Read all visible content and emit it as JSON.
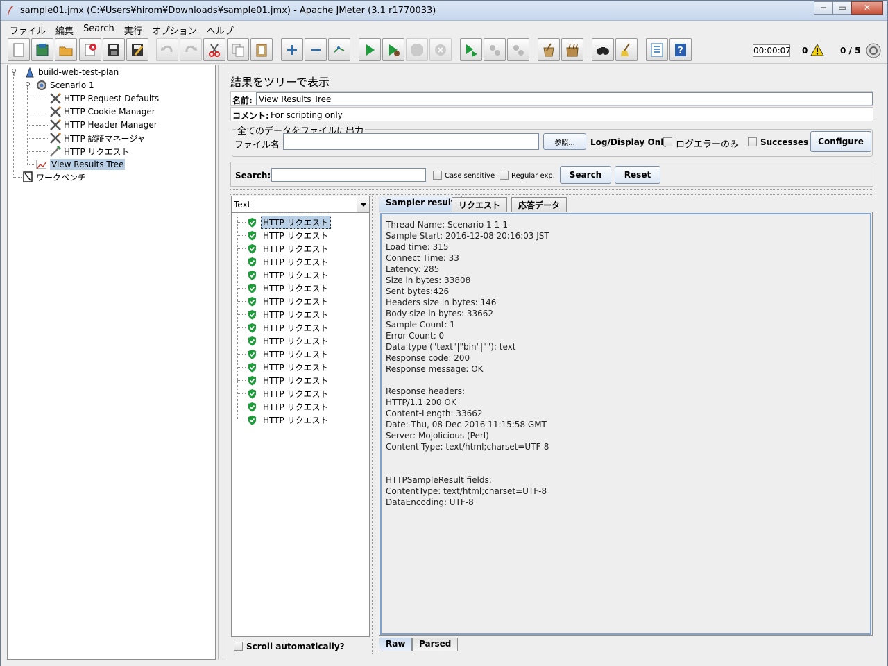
{
  "window": {
    "title": "sample01.jmx (C:¥Users¥hirom¥Downloads¥sample01.jmx) - Apache JMeter (3.1 r1770033)",
    "minimize": "─",
    "maximize": "▭",
    "close": "✕"
  },
  "menu": [
    "ファイル",
    "編集",
    "Search",
    "実行",
    "オプション",
    "ヘルプ"
  ],
  "toolbar": {
    "buttons": [
      {
        "name": "new-icon"
      },
      {
        "name": "templates-icon"
      },
      {
        "name": "open-icon"
      },
      {
        "name": "close-icon"
      },
      {
        "name": "save-icon"
      },
      {
        "name": "save-as-icon"
      },
      {
        "name": "undo-icon"
      },
      {
        "name": "redo-icon"
      },
      {
        "name": "cut-icon"
      },
      {
        "name": "copy-icon"
      },
      {
        "name": "paste-icon"
      },
      {
        "name": "expand-icon"
      },
      {
        "name": "collapse-icon"
      },
      {
        "name": "toggle-icon"
      },
      {
        "name": "start-icon"
      },
      {
        "name": "start-no-pause-icon"
      },
      {
        "name": "stop-icon"
      },
      {
        "name": "shutdown-icon"
      },
      {
        "name": "remote-start-icon"
      },
      {
        "name": "remote-stop-icon"
      },
      {
        "name": "remote-shutdown-icon"
      },
      {
        "name": "clear-icon"
      },
      {
        "name": "clear-all-icon"
      },
      {
        "name": "search-icon"
      },
      {
        "name": "reset-search-icon"
      },
      {
        "name": "function-helper-icon"
      },
      {
        "name": "help-icon"
      }
    ],
    "elapsed": "00:00:07",
    "error_count": "0",
    "threads": "0 / 5"
  },
  "tree": {
    "nodes": [
      {
        "label": "build-web-test-plan",
        "icon": "test-plan-icon"
      },
      {
        "label": "Scenario 1",
        "icon": "thread-group-icon"
      },
      {
        "label": "HTTP Request Defaults",
        "icon": "config-tools-icon"
      },
      {
        "label": "HTTP Cookie Manager",
        "icon": "config-tools-icon"
      },
      {
        "label": "HTTP Header Manager",
        "icon": "config-tools-icon"
      },
      {
        "label": "HTTP 認証マネージャ",
        "icon": "config-tools-icon"
      },
      {
        "label": "HTTP リクエスト",
        "icon": "sampler-pipette-icon"
      },
      {
        "label": "View Results Tree",
        "icon": "listener-graph-icon"
      },
      {
        "label": "ワークベンチ",
        "icon": "workbench-icon"
      }
    ]
  },
  "panel": {
    "title": "結果をツリーで表示",
    "name_label": "名前:",
    "name_value": "View Results Tree",
    "comment_label": "コメント:",
    "comment_value": "For scripting only",
    "file_group_title": "全てのデータをファイルに出力",
    "file_label": "ファイル名",
    "browse_label": "参照...",
    "log_display_label": "Log/Display Only:",
    "errors_only_label": "ログエラーのみ",
    "successes_label": "Successes",
    "configure_label": "Configure",
    "search_label": "Search:",
    "case_sensitive_label": "Case sensitive",
    "regex_label": "Regular exp.",
    "search_button": "Search",
    "reset_button": "Reset"
  },
  "results": {
    "renderer": "Text",
    "items": [
      "HTTP リクエスト",
      "HTTP リクエスト",
      "HTTP リクエスト",
      "HTTP リクエスト",
      "HTTP リクエスト",
      "HTTP リクエスト",
      "HTTP リクエスト",
      "HTTP リクエスト",
      "HTTP リクエスト",
      "HTTP リクエスト",
      "HTTP リクエスト",
      "HTTP リクエスト",
      "HTTP リクエスト",
      "HTTP リクエスト",
      "HTTP リクエスト",
      "HTTP リクエスト"
    ],
    "scroll_auto_label": "Scroll automatically?",
    "tabs": [
      "Sampler result",
      "リクエスト",
      "応答データ"
    ],
    "bottom_tabs": [
      "Raw",
      "Parsed"
    ],
    "lines": [
      "Thread Name: Scenario 1 1-1",
      "Sample Start: 2016-12-08 20:16:03 JST",
      "Load time: 315",
      "Connect Time: 33",
      "Latency: 285",
      "Size in bytes: 33808",
      "Sent bytes:426",
      "Headers size in bytes: 146",
      "Body size in bytes: 33662",
      "Sample Count: 1",
      "Error Count: 0",
      "Data type (\"text\"|\"bin\"|\"\"): text",
      "Response code: 200",
      "Response message: OK",
      "",
      "Response headers:",
      "HTTP/1.1 200 OK",
      "Content-Length: 33662",
      "Date: Thu, 08 Dec 2016 11:15:58 GMT",
      "Server: Mojolicious (Perl)",
      "Content-Type: text/html;charset=UTF-8",
      "",
      "",
      "HTTPSampleResult fields:",
      "ContentType: text/html;charset=UTF-8",
      "DataEncoding: UTF-8"
    ]
  }
}
